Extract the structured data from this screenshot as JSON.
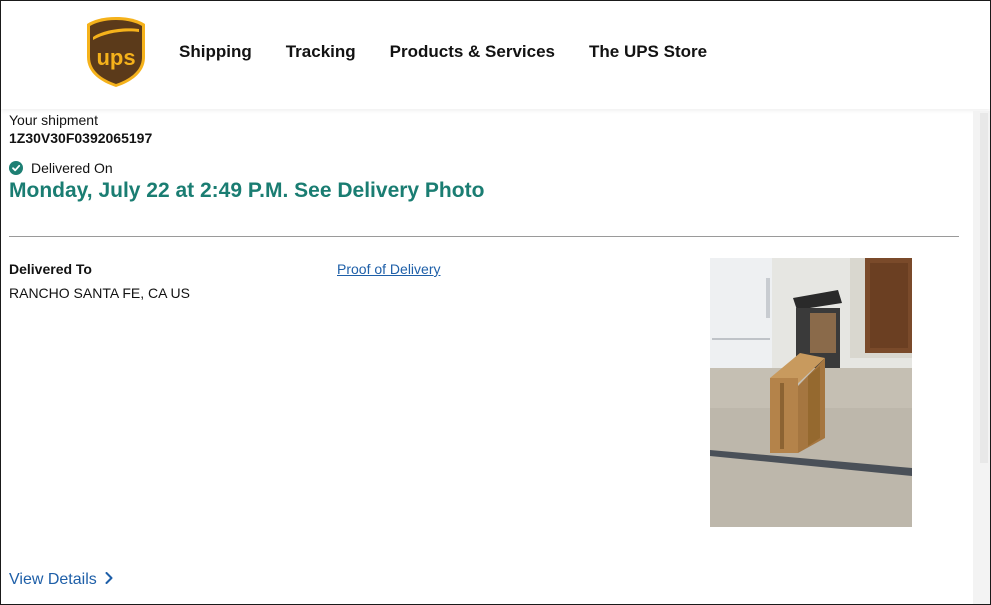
{
  "header": {
    "logo_text": "ups",
    "nav": [
      {
        "label": "Shipping"
      },
      {
        "label": "Tracking"
      },
      {
        "label": "Products & Services"
      },
      {
        "label": "The UPS Store"
      }
    ]
  },
  "shipment": {
    "label": "Your shipment",
    "tracking_number": "1Z30V30F0392065197",
    "status_label": "Delivered On",
    "delivery_datetime": "Monday, July 22 at 2:49 P.M.",
    "see_photo_link": "See Delivery Photo",
    "delivered_to_label": "Delivered To",
    "delivered_to_value": "RANCHO SANTA FE, CA US",
    "proof_of_delivery_link": "Proof of Delivery",
    "view_details_link": "View Details"
  },
  "colors": {
    "brand_brown": "#5b3a1a",
    "brand_gold": "#f5b21b",
    "status_green": "#1a7d72",
    "link_blue": "#1e5fa8"
  },
  "icons": {
    "status": "check-circle-icon",
    "view_details": "chevron-right-icon"
  }
}
